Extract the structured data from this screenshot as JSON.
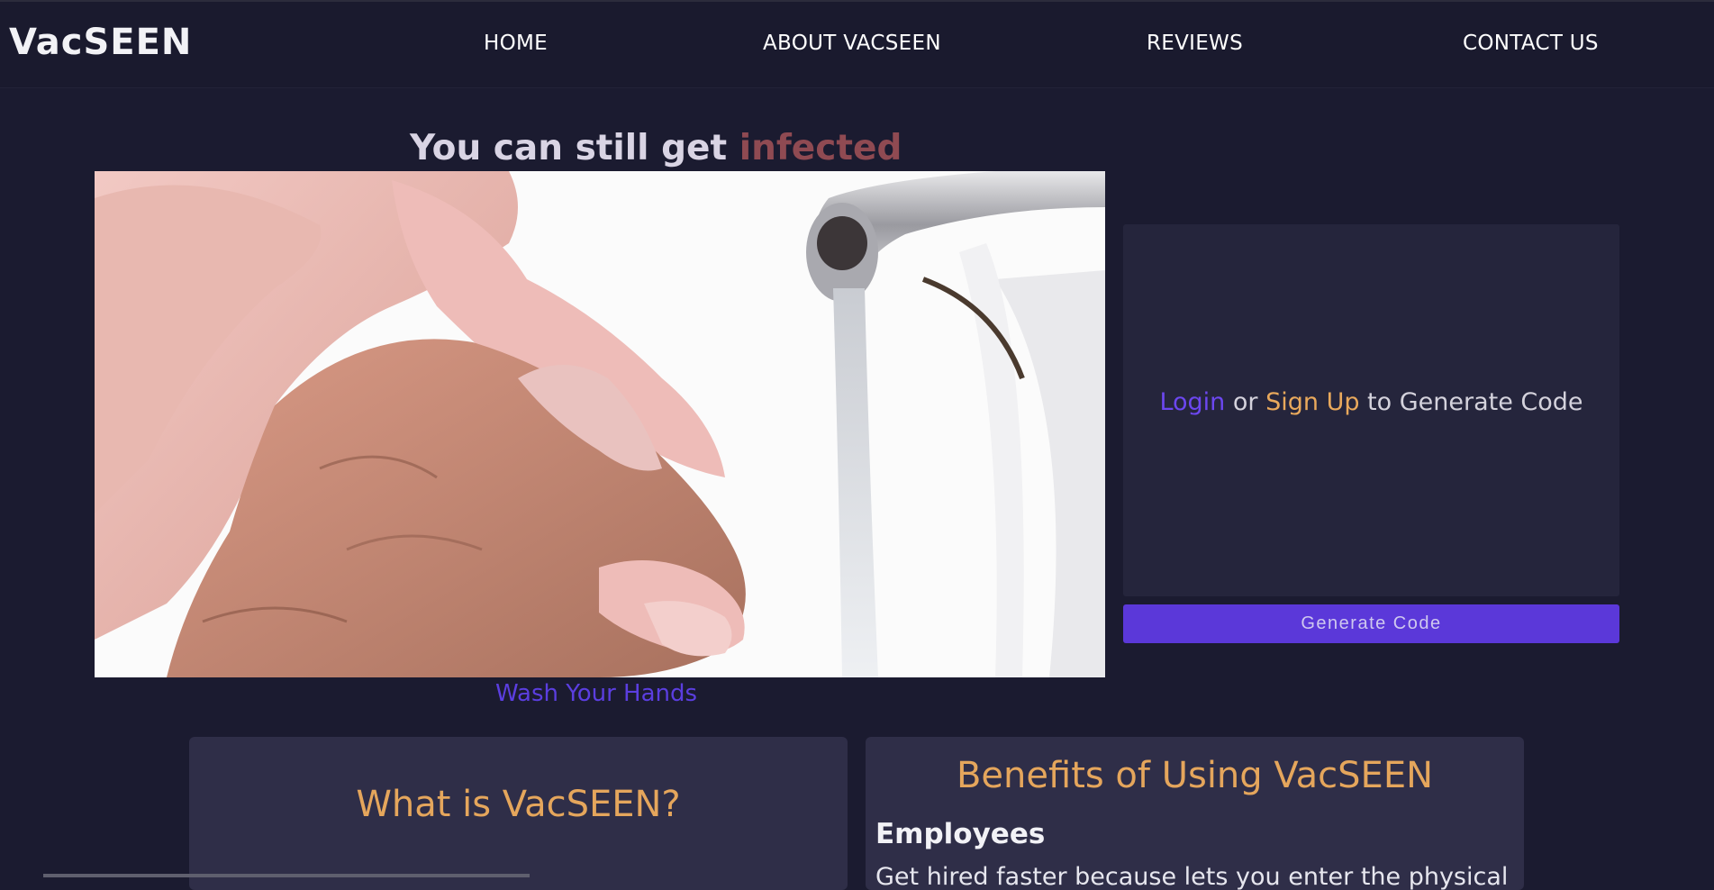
{
  "header": {
    "logo": "VacSEEN",
    "nav": {
      "home": "HOME",
      "about": "ABOUT VACSEEN",
      "reviews": "REVIEWS",
      "contact": "CONTACT US"
    }
  },
  "hero": {
    "headline_prefix": "You can still get ",
    "headline_accent": "infected",
    "caption": "Wash Your Hands"
  },
  "code_panel": {
    "login": "Login",
    "or": " or ",
    "signup": "Sign Up",
    "suffix": " to Generate Code",
    "button": "Generate Code"
  },
  "cards": {
    "what": {
      "title": "What is VacSEEN?"
    },
    "benefits": {
      "title": "Benefits of Using VacSEEN",
      "subhead": "Employees",
      "body": "Get hired faster because lets you enter the physical"
    }
  },
  "colors": {
    "background": "#1b1b30",
    "accent_purple": "#5b38d9",
    "accent_orange": "#e5a65c",
    "accent_red": "#8f4a52"
  }
}
